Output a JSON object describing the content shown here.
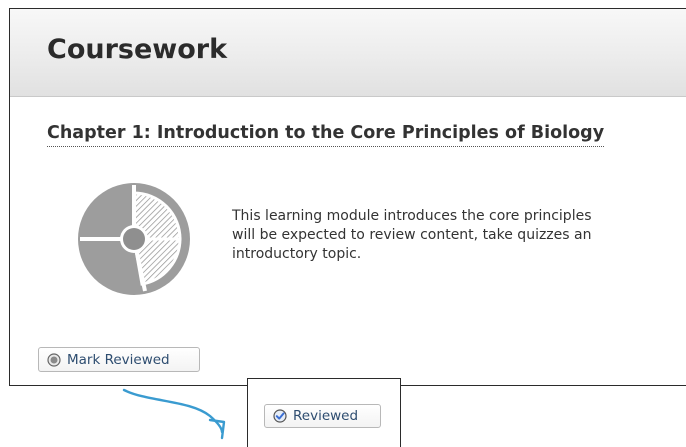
{
  "panel": {
    "title": "Coursework"
  },
  "chapter": {
    "title": "Chapter 1: Introduction to the Core Principles of Biology",
    "description_lines": [
      "This learning module introduces the core principles",
      "will be expected to review content, take quizzes an",
      "introductory topic."
    ],
    "icon": "module-pie-icon"
  },
  "buttons": {
    "mark_reviewed": {
      "label": "Mark Reviewed",
      "icon": "unchecked-circle-icon"
    },
    "reviewed": {
      "label": "Reviewed",
      "icon": "checked-circle-icon"
    }
  },
  "colors": {
    "link_text": "#2e4d70",
    "arrow": "#3a9bd0",
    "icon_gray": "#999999",
    "check_blue": "#3b6fd4"
  }
}
